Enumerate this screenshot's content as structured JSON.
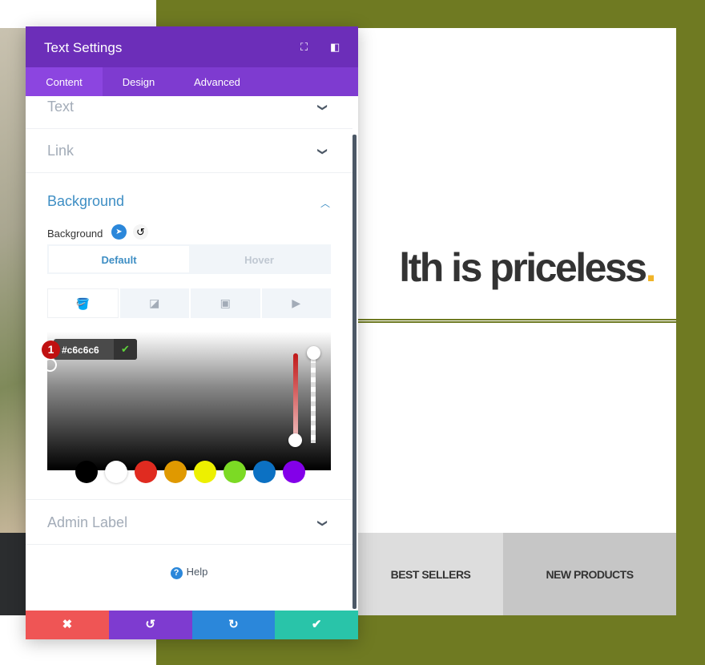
{
  "page": {
    "headline": "lth is priceless",
    "headline_dot": ".",
    "categories": [
      "BEST SELLERS",
      "NEW PRODUCTS"
    ]
  },
  "panel": {
    "title": "Text Settings",
    "header_icons": [
      "fullscreen-icon",
      "sidebar-toggle-icon"
    ],
    "tabs": [
      {
        "label": "Content",
        "active": true
      },
      {
        "label": "Design"
      },
      {
        "label": "Advanced"
      }
    ],
    "sections": {
      "text": "Text",
      "link": "Link",
      "background": "Background",
      "admin_label": "Admin Label"
    },
    "background": {
      "label": "Background",
      "states": [
        "Default",
        "Hover"
      ],
      "active_state": "Default",
      "type_icons": [
        "paint-bucket-icon",
        "gradient-icon",
        "image-icon",
        "video-icon"
      ],
      "hex_value": "#c6c6c6",
      "badge": "1",
      "swatches": [
        "#000000",
        "#ffffff",
        "#e02b20",
        "#e09900",
        "#edf000",
        "#7cda24",
        "#0c71c3",
        "#8300e9"
      ]
    },
    "help": "Help",
    "footer": {
      "cancel": "✖",
      "undo": "↺",
      "redo": "↻",
      "save": "✔"
    }
  },
  "colors": {
    "header": "#6c2eb9",
    "tabs": "#7e3bd0",
    "olive": "#6f7a22",
    "cancel": "#ef5555",
    "undo": "#7e3bd0",
    "redo": "#2b87da",
    "save": "#29c4a9"
  }
}
